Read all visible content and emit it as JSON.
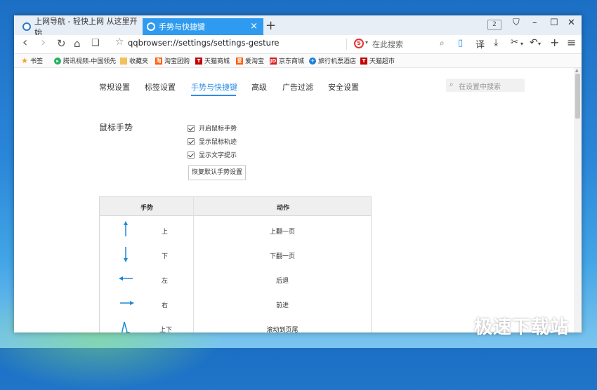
{
  "tabs": [
    {
      "title": "上网导航 - 轻快上网 从这里开始"
    },
    {
      "title": "手势与快捷键",
      "close": "×"
    }
  ],
  "new_tab": "+",
  "tab_count": "2",
  "window_buttons": {
    "shirt": "⛉",
    "minimize": "–",
    "maximize": "☐",
    "close": "✕"
  },
  "toolbar": {
    "back": "‹",
    "forward": "›",
    "reload": "↻",
    "home": "⌂",
    "reader": "❑",
    "star": "☆",
    "address": "qqbrowser://settings/settings-gesture",
    "search_engine": "S",
    "search_placeholder": "在此搜索",
    "translate": "译",
    "download": "⤓",
    "cut": "✂",
    "undo": "↶",
    "add": "+",
    "menu": "≡"
  },
  "bookmarks": [
    {
      "label": "书签",
      "icon": "star-icon",
      "color": "#f0a020"
    },
    {
      "label": "腾讯视频-中国领先",
      "icon": "play-icon",
      "color": "#22b35f"
    },
    {
      "label": "收藏夹",
      "icon": "folder-icon",
      "color": "#f3c15b"
    },
    {
      "label": "淘宝团购",
      "icon": "taobao-icon",
      "color": "#ff5a00"
    },
    {
      "label": "天猫商城",
      "icon": "tmall-icon",
      "color": "#c40000"
    },
    {
      "label": "爱淘宝",
      "icon": "aitaobao-icon",
      "color": "#ff5a00"
    },
    {
      "label": "京东商城",
      "icon": "jd-icon",
      "color": "#d71c1e"
    },
    {
      "label": "旅行机票酒店",
      "icon": "travel-icon",
      "color": "#1e7fd8"
    },
    {
      "label": "天猫超市",
      "icon": "tmall-icon",
      "color": "#c40000"
    }
  ],
  "settings": {
    "menu": [
      "常规设置",
      "标签设置",
      "手势与快捷键",
      "高级",
      "广告过滤",
      "安全设置"
    ],
    "active_menu": "手势与快捷键",
    "search_placeholder": "在设置中搜索",
    "section_label": "鼠标手势",
    "checkboxes": [
      {
        "label": "开启鼠标手势",
        "checked": true
      },
      {
        "label": "显示鼠标轨迹",
        "checked": true
      },
      {
        "label": "显示文字提示",
        "checked": true
      }
    ],
    "reset_button": "恢复默认手势设置",
    "table": {
      "headers": [
        "手势",
        "动作"
      ],
      "rows": [
        {
          "gesture": "上",
          "action": "上翻一页",
          "arrow": "arrow-up-icon"
        },
        {
          "gesture": "下",
          "action": "下翻一页",
          "arrow": "arrow-down-icon"
        },
        {
          "gesture": "左",
          "action": "后退",
          "arrow": "arrow-left-icon"
        },
        {
          "gesture": "右",
          "action": "前进",
          "arrow": "arrow-right-icon"
        },
        {
          "gesture": "上下",
          "action": "滚动到页尾",
          "arrow": "arrow-up-down-icon"
        }
      ]
    }
  },
  "colors": {
    "accent": "#2f8ee6",
    "arrow": "#1b8ad6",
    "active_tab": "#2f9bf0"
  },
  "watermark": "极速下载站"
}
